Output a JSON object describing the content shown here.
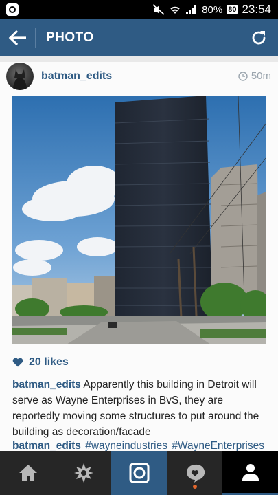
{
  "status_bar": {
    "battery_percent": "80%",
    "battery_badge": "80",
    "time": "23:54"
  },
  "header": {
    "title": "PHOTO"
  },
  "post": {
    "username": "batman_edits",
    "time_ago": "50m",
    "likes": "20 likes",
    "caption_user": "batman_edits",
    "caption_text": " Apparently this building in Detroit will serve as Wayne Enterprises in BvS, they are reportedly moving some structures to put around the building as decoration/facade",
    "comment_user": "batman_edits",
    "hashtags": [
      "#wayneindustries",
      "#WayneEnterprises"
    ]
  },
  "nav": {
    "items": [
      "home-icon",
      "explore-icon",
      "camera-icon",
      "activity-icon",
      "profile-icon"
    ]
  },
  "colors": {
    "accent": "#2f5b84",
    "notification": "#e2662c"
  }
}
